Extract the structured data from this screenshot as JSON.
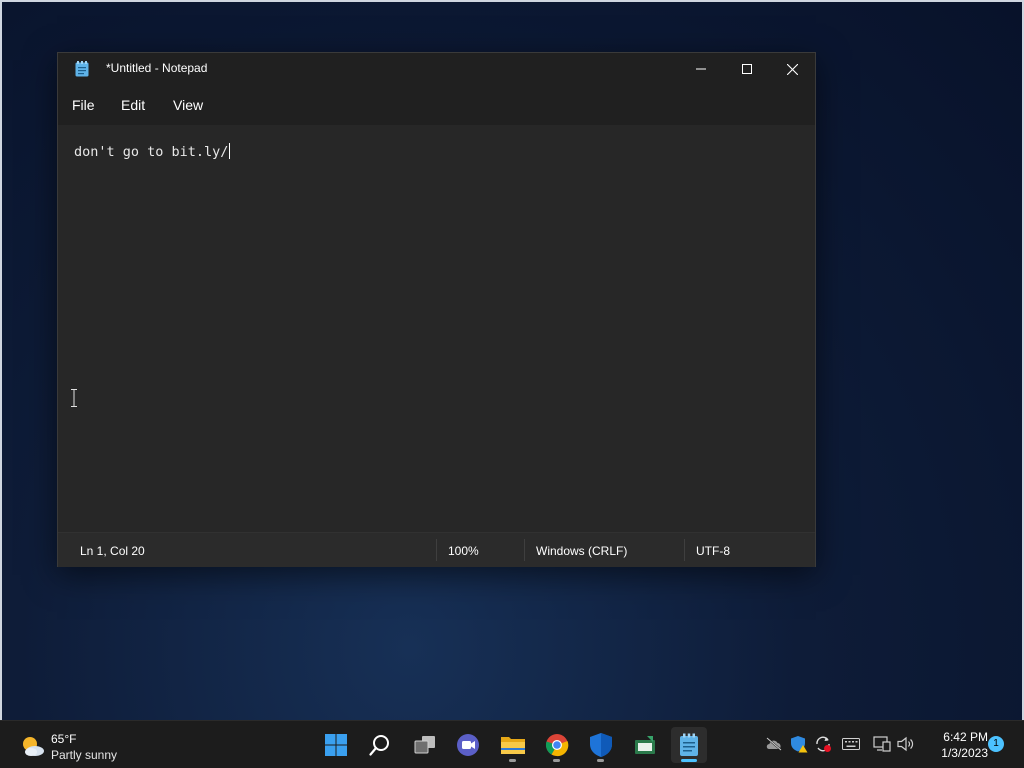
{
  "window": {
    "title": "*Untitled - Notepad",
    "menu": [
      "File",
      "Edit",
      "View"
    ],
    "editor_text": "don't go to bit.ly/",
    "status": {
      "position": "Ln 1, Col 20",
      "zoom": "100%",
      "line_ending": "Windows (CRLF)",
      "encoding": "UTF-8"
    }
  },
  "taskbar": {
    "weather": {
      "temp": "65°F",
      "desc": "Partly sunny"
    },
    "apps": [
      "start-icon",
      "search-icon",
      "task-view-icon",
      "chat-icon",
      "file-explorer-icon",
      "chrome-icon",
      "defender-icon",
      "app-icon",
      "notepad-icon"
    ],
    "clock": {
      "time": "6:42 PM",
      "date": "1/3/2023"
    },
    "notifications": "1"
  },
  "colors": {
    "accent": "#4cc2ff",
    "window_bg": "#272727",
    "titlebar_bg": "#202020",
    "taskbar_bg": "#1c1c1c"
  }
}
